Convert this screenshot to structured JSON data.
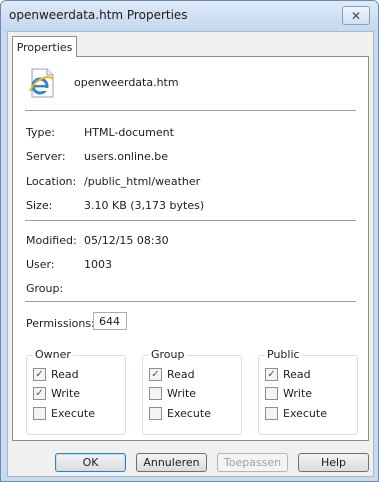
{
  "window": {
    "title": "openweerdata.htm Properties"
  },
  "tab": {
    "label": "Properties"
  },
  "file": {
    "name": "openweerdata.htm"
  },
  "info": {
    "type_label": "Type:",
    "type_value": "HTML-document",
    "server_label": "Server:",
    "server_value": "users.online.be",
    "location_label": "Location:",
    "location_value": "/public_html/weather",
    "size_label": "Size:",
    "size_value": "3.10 KB (3,173 bytes)",
    "modified_label": "Modified:",
    "modified_value": "05/12/15 08:30",
    "user_label": "User:",
    "user_value": "1003",
    "group_label": "Group:",
    "group_value": ""
  },
  "permissions": {
    "label": "Permissions:",
    "value": "644"
  },
  "groups": {
    "owner": {
      "title": "Owner",
      "read": "Read",
      "write": "Write",
      "execute": "Execute",
      "read_checked": true,
      "write_checked": true,
      "execute_checked": false
    },
    "group": {
      "title": "Group",
      "read": "Read",
      "write": "Write",
      "execute": "Execute",
      "read_checked": true,
      "write_checked": false,
      "execute_checked": false
    },
    "public": {
      "title": "Public",
      "read": "Read",
      "write": "Write",
      "execute": "Execute",
      "read_checked": true,
      "write_checked": false,
      "execute_checked": false
    }
  },
  "buttons": {
    "ok": "OK",
    "cancel": "Annuleren",
    "apply": "Toepassen",
    "help": "Help"
  },
  "icons": {
    "close": "close-icon",
    "file": "html-file-icon"
  }
}
